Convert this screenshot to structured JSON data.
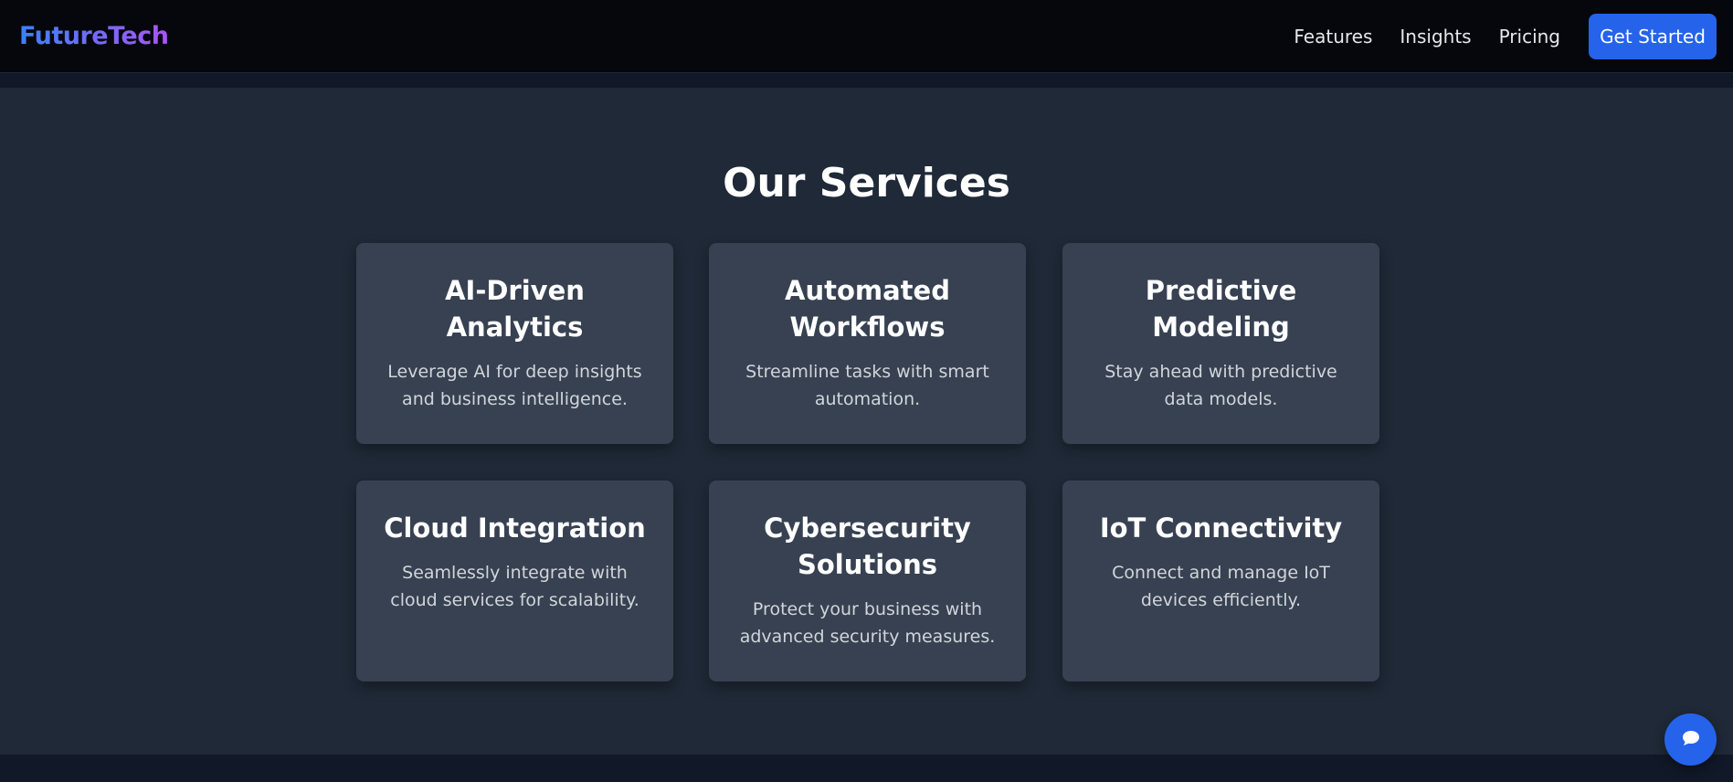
{
  "nav": {
    "logo": "FutureTech",
    "links": [
      "Features",
      "Insights",
      "Pricing"
    ],
    "cta": "Get Started"
  },
  "services": {
    "title": "Our Services",
    "cards": [
      {
        "title": "AI-Driven Analytics",
        "desc": "Leverage AI for deep insights and business intelligence."
      },
      {
        "title": "Automated Workflows",
        "desc": "Streamline tasks with smart automation."
      },
      {
        "title": "Predictive Modeling",
        "desc": "Stay ahead with predictive data models."
      },
      {
        "title": "Cloud Integration",
        "desc": "Seamlessly integrate with cloud services for scalability."
      },
      {
        "title": "Cybersecurity Solutions",
        "desc": "Protect your business with advanced security measures."
      },
      {
        "title": "IoT Connectivity",
        "desc": "Connect and manage IoT devices efficiently."
      }
    ]
  },
  "chat": {
    "icon": "chat-bubble-icon"
  },
  "colors": {
    "accent": "#2563eb",
    "nav_bg": "#05070c",
    "section_bg": "#1f2937",
    "card_bg": "#374151",
    "logo_gradient_start": "#3b82f6",
    "logo_gradient_end": "#a855f7"
  }
}
